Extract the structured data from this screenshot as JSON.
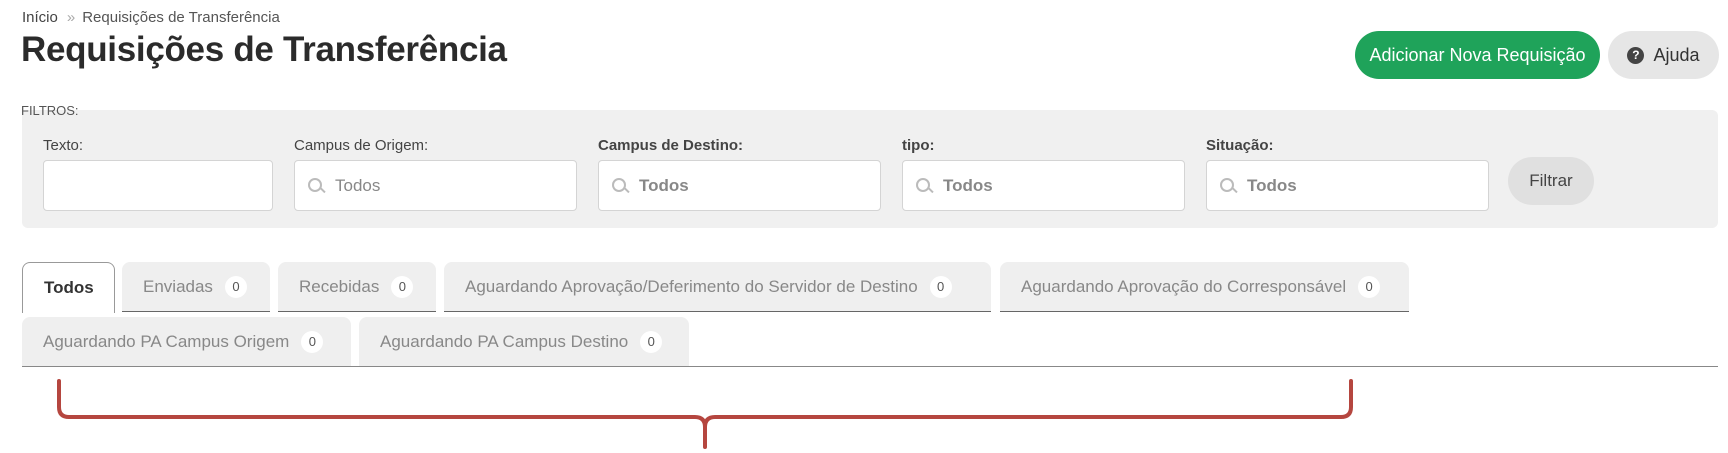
{
  "breadcrumb": {
    "home": "Início",
    "separator": "»",
    "current": "Requisições de Transferência"
  },
  "page": {
    "title": "Requisições de Transferência"
  },
  "actions": {
    "add_label": "Adicionar Nova Requisição",
    "help_label": "Ajuda",
    "help_icon": "question-circle-icon"
  },
  "filters": {
    "legend": "FILTROS:",
    "texto": {
      "label": "Texto:",
      "value": ""
    },
    "campus_origem": {
      "label": "Campus de Origem:",
      "value": "Todos"
    },
    "campus_destino": {
      "label": "Campus de Destino:",
      "value": "Todos"
    },
    "tipo": {
      "label": "tipo:",
      "value": "Todos"
    },
    "situacao": {
      "label": "Situação:",
      "value": "Todos"
    },
    "submit_label": "Filtrar"
  },
  "tabs": [
    {
      "label": "Todos",
      "count": null,
      "active": true
    },
    {
      "label": "Enviadas",
      "count": "0"
    },
    {
      "label": "Recebidas",
      "count": "0"
    },
    {
      "label": "Aguardando Aprovação/Deferimento do Servidor de Destino",
      "count": "0"
    },
    {
      "label": "Aguardando Aprovação do Corresponsável",
      "count": "0"
    },
    {
      "label": "Aguardando PA Campus Origem",
      "count": "0"
    },
    {
      "label": "Aguardando PA Campus Destino",
      "count": "0"
    }
  ],
  "colors": {
    "primary_green": "#1fa35a",
    "annotation_red": "#b5463f"
  }
}
